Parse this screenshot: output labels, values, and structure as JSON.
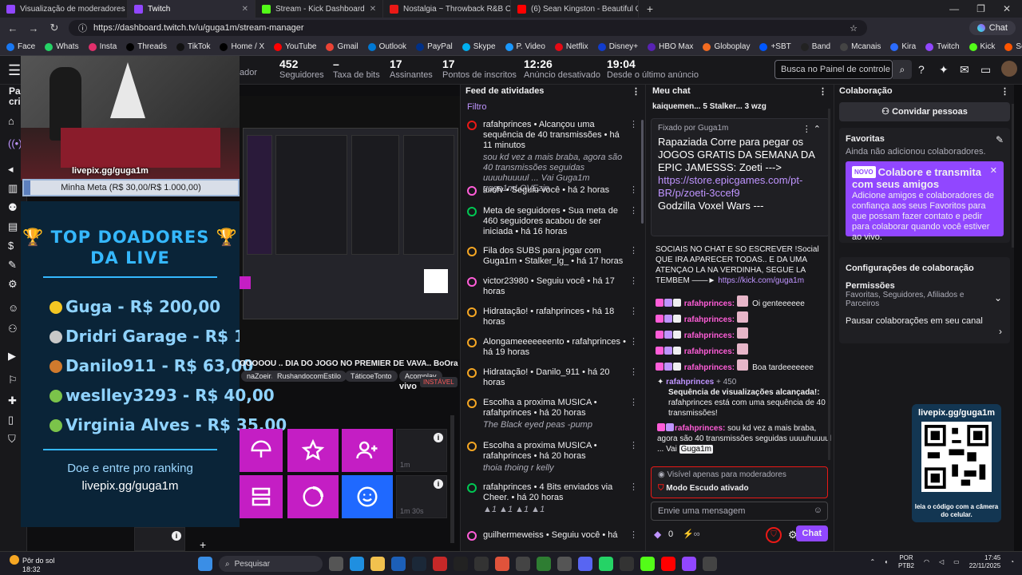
{
  "browser": {
    "tabs": [
      {
        "label": "Visualização de moderadores",
        "icon_color": "#9147ff"
      },
      {
        "label": "Twitch",
        "icon_color": "#9147ff",
        "active": true
      },
      {
        "label": "Stream - Kick Dashboard",
        "icon_color": "#53fc18"
      },
      {
        "label": "Nostalgia ~ Throwback R&B Classics",
        "icon_color": "#e91916"
      },
      {
        "label": "(6) Sean Kingston - Beautiful Girls",
        "icon_color": "#ff0000"
      }
    ],
    "url": "https://dashboard.twitch.tv/u/guga1m/stream-manager",
    "chat_button": "Chat",
    "bookmarks": [
      "Face",
      "Whats",
      "Insta",
      "Threads",
      "TikTok",
      "Home / X",
      "YouTube",
      "Gmail",
      "Outlook",
      "PayPal",
      "Skype",
      "P. Video",
      "Netflix",
      "Disney+",
      "HBO Max",
      "Globoplay",
      "+SBT",
      "Band",
      "Mcanais",
      "Kira",
      "Twitch",
      "Kick",
      "SoundCloud",
      "Cartola"
    ]
  },
  "header": {
    "partial_label": "ador",
    "stats": [
      {
        "value": "452",
        "label": "Seguidores"
      },
      {
        "value": "–",
        "label": "Taxa de bits"
      },
      {
        "value": "17",
        "label": "Assinantes"
      },
      {
        "value": "17",
        "label": "Pontos de inscritos"
      },
      {
        "value": "12:26",
        "label": "Anúncio desativado"
      },
      {
        "value": "19:04",
        "label": "Desde o último anúncio"
      }
    ],
    "search_placeholder": "Busca no Painel de controle (C"
  },
  "sidebar": {
    "partial_title": "Pai cria"
  },
  "overlay": {
    "cam_tag": "livepix.gg/guga1m",
    "goal_label": "Minha Meta (R$ 30,00/R$ 1.000,00)",
    "goal_progress": 0.03,
    "donors_title_1": "🏆 TOP DOADORES 🏆",
    "donors_title_2": "DA LIVE",
    "donors": [
      {
        "text": "Guga - R$ 200,00",
        "medal": "#f3c623"
      },
      {
        "text": "Dridri Garage - R$ 100,00",
        "medal": "#c8c8c8"
      },
      {
        "text": "Danilo911 - R$ 63,00",
        "medal": "#d07a2d"
      },
      {
        "text": "weslley3293 - R$ 40,00",
        "medal": "#7bc34a"
      },
      {
        "text": "Virginia Alves - R$ 35,00",
        "medal": "#7bc34a"
      }
    ],
    "cta": "Doe e entre pro ranking",
    "cta_url": "livepix.gg/guga1m"
  },
  "preview": {
    "ticker": "OOOOOU .. DIA DO JOGO NO PREMIER DE VAVA.. BoOra ..SO FA",
    "chips": [
      "naZoeira",
      "RushandocomEstilo",
      "TáticoeTonto",
      "Acomplay"
    ],
    "live_label": "vivo",
    "unstable_label": "INSTÁVEL"
  },
  "quick_actions": {
    "placeholders": [
      {
        "time": "1m"
      },
      {
        "time": "1m 30s"
      }
    ]
  },
  "feed": {
    "title": "Feed de atividades",
    "filter": "Filtro",
    "items": [
      {
        "icon_color": "#e91916",
        "text": "rafahprinces • Alcançou uma sequência de 40 transmissões • há 11 minutos",
        "sub": "sou kd vez a mais braba, agora são 40 transmissões seguidas uuuuhuuuul ... Vai Guga1m guga1mLOVEzin"
      },
      {
        "icon_color": "#ff5dd8",
        "text": "luiofv • Seguiu você • há 2 horas",
        "sub": ""
      },
      {
        "icon_color": "#00c853",
        "text": "Meta de seguidores • Sua meta de 460 seguidores acabou de ser iniciada • há 16 horas",
        "sub": ""
      },
      {
        "icon_color": "#f5a623",
        "text": "Fila dos SUBS para jogar com Guga1m • Stalker_lg_ • há 17 horas",
        "sub": ""
      },
      {
        "icon_color": "#ff5dd8",
        "text": "victor23980 • Seguiu você • há 17 horas",
        "sub": ""
      },
      {
        "icon_color": "#f5a623",
        "text": "Hidratação! • rafahprinces • há 18 horas",
        "sub": ""
      },
      {
        "icon_color": "#f5a623",
        "text": "Alongameeeeeeento • rafahprinces • há 19 horas",
        "sub": ""
      },
      {
        "icon_color": "#f5a623",
        "text": "Hidratação! • Danilo_911 • há 20 horas",
        "sub": ""
      },
      {
        "icon_color": "#f5a623",
        "text": "Escolha a proxima MUSICA • rafahprinces • há 20 horas",
        "sub": "The Black eyed peas -pump"
      },
      {
        "icon_color": "#f5a623",
        "text": "Escolha a proxima MUSICA • rafahprinces • há 20 horas",
        "sub": "thoia thoing r kelly"
      },
      {
        "icon_color": "#00c853",
        "text": "rafahprinces • 4 Bits enviados via Cheer. • há 20 horas",
        "sub": "▲1 ▲1 ▲1 ▲1"
      },
      {
        "icon_color": "#ff5dd8",
        "text": "guilhermeweiss • Seguiu você • há",
        "sub": ""
      }
    ]
  },
  "chat": {
    "title": "Meu chat",
    "top_gifters": "kaiquemen... 5   Stalker... 3   wzg",
    "pinned_by": "Fixado por  Guga1m",
    "pinned_msg": "Rapaziada Corre para pegar os JOGOS GRATIS DA SEMANA DA EPIC JAMESSS: Zoeti --->",
    "pinned_link": "https://store.epicgames.com/pt-BR/p/zoeti-3ccef9",
    "pinned_tail": "Godzilla Voxel Wars ---",
    "social_msg": "SOCIAIS NO CHAT E SO ESCREVER !Social QUE IRA APARECER TODAS.. E DA UMA ATENÇAO LA NA VERDINHA, SEGUE LA TEMBEM ——►",
    "social_link": "https://kick.com/guga1m",
    "messages": [
      {
        "user": "rafahprinces:",
        "text": "Oi genteeeeee"
      },
      {
        "user": "rafahprinces:",
        "text": ""
      },
      {
        "user": "rafahprinces:",
        "text": ""
      },
      {
        "user": "rafahprinces:",
        "text": ""
      },
      {
        "user": "rafahprinces:",
        "text": "Boa tardeeeeeee"
      }
    ],
    "streak_user": "rafahprinces",
    "streak_points": "+ 450",
    "streak_title": "Sequência de visualizações alcançada!:",
    "streak_text": "rafahprinces está com uma sequência de 40 transmissões!",
    "last_user": "rafahprinces:",
    "last_text": "sou kd vez a mais braba, agora são 40 transmissões seguidas uuuuhuuuul ... Vai",
    "last_mention": "Guga1m",
    "mod_visible": "Visível apenas para moderadores",
    "shield_mode": "Modo Escudo ativado",
    "input_placeholder": "Envie uma mensagem",
    "points": "0",
    "send": "Chat"
  },
  "collab": {
    "title": "Colaboração",
    "invite": "Convidar pessoas",
    "favorites_title": "Favoritas",
    "favorites_empty": "Ainda não adicionou colaboradores.",
    "promo_new": "NOVO",
    "promo_title": "Colabore e transmita com seus amigos",
    "promo_text": "Adicione amigos e colaboradores de confiança aos seus Favoritos para que possam fazer contato e pedir para colaborar quando você estiver ao vivo.",
    "settings_title": "Configurações de colaboração",
    "permissions_title": "Permissões",
    "permissions_value": "Favoritas, Seguidores, Afiliados e Parceiros",
    "pause": "Pausar colaborações em seu canal"
  },
  "qr_panel": {
    "title": "livepix.gg/guga1m",
    "footer": "leia o código com a câmera do celular."
  },
  "taskbar": {
    "weather_title": "Pôr do sol",
    "weather_time": "18:32",
    "search": "Pesquisar",
    "lang": "POR",
    "layout": "PTB2",
    "time": "17:45",
    "date": "22/11/2025"
  }
}
